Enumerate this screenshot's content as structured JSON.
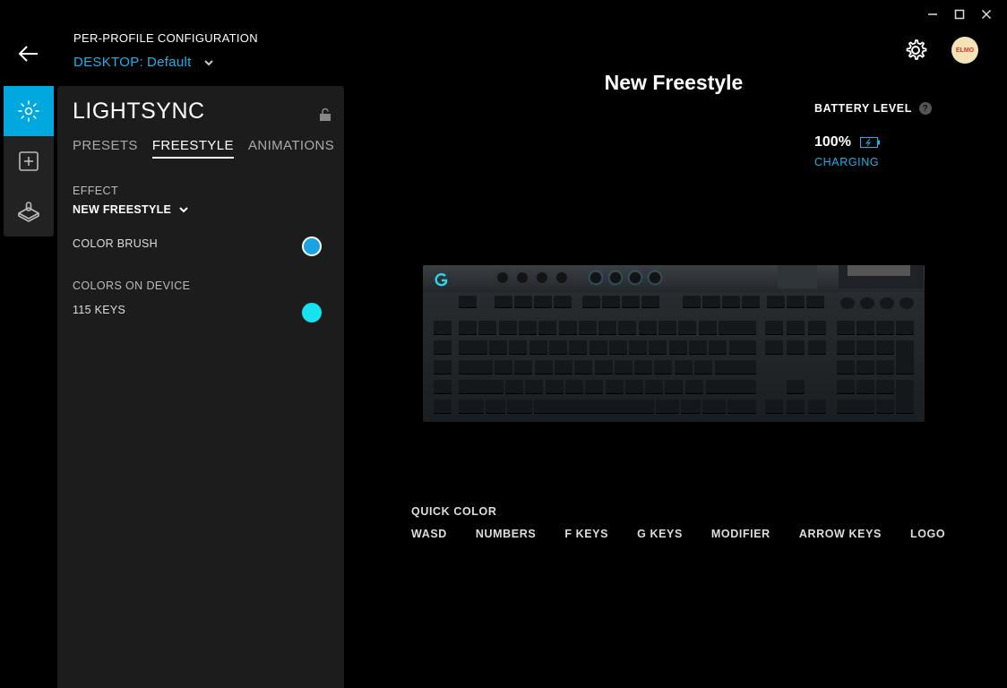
{
  "window": {
    "controls": [
      "minimize",
      "maximize",
      "close"
    ]
  },
  "header": {
    "section_title": "PER-PROFILE CONFIGURATION",
    "profile_prefix": "DESKTOP:",
    "profile_name": "Default",
    "avatar_text": "ELMO"
  },
  "rail": {
    "items": [
      {
        "icon": "lightsync-icon",
        "active": true
      },
      {
        "icon": "assignments-icon",
        "active": false
      },
      {
        "icon": "game-mode-icon",
        "active": false
      }
    ]
  },
  "panel": {
    "title": "LIGHTSYNC",
    "tabs": [
      {
        "label": "PRESETS",
        "active": false
      },
      {
        "label": "FREESTYLE",
        "active": true
      },
      {
        "label": "ANIMATIONS",
        "active": false
      }
    ],
    "effect_label": "EFFECT",
    "effect_value": "NEW FREESTYLE",
    "color_brush_label": "COLOR BRUSH",
    "color_brush_color": "#1aa3e0",
    "colors_on_device_label": "COLORS ON DEVICE",
    "device_keys_label": "115 KEYS",
    "device_color": "#16e2f0"
  },
  "main": {
    "title": "New Freestyle",
    "battery_label": "BATTERY LEVEL",
    "battery_help": "?",
    "battery_percent": "100%",
    "battery_level": 1.0,
    "battery_status": "CHARGING",
    "quick_color_label": "QUICK COLOR",
    "quick_colors": [
      "WASD",
      "NUMBERS",
      "F KEYS",
      "G KEYS",
      "MODIFIER",
      "ARROW KEYS",
      "LOGO"
    ]
  },
  "colors": {
    "accent": "#00a8e0",
    "key_glow": "#2fd6e8"
  }
}
